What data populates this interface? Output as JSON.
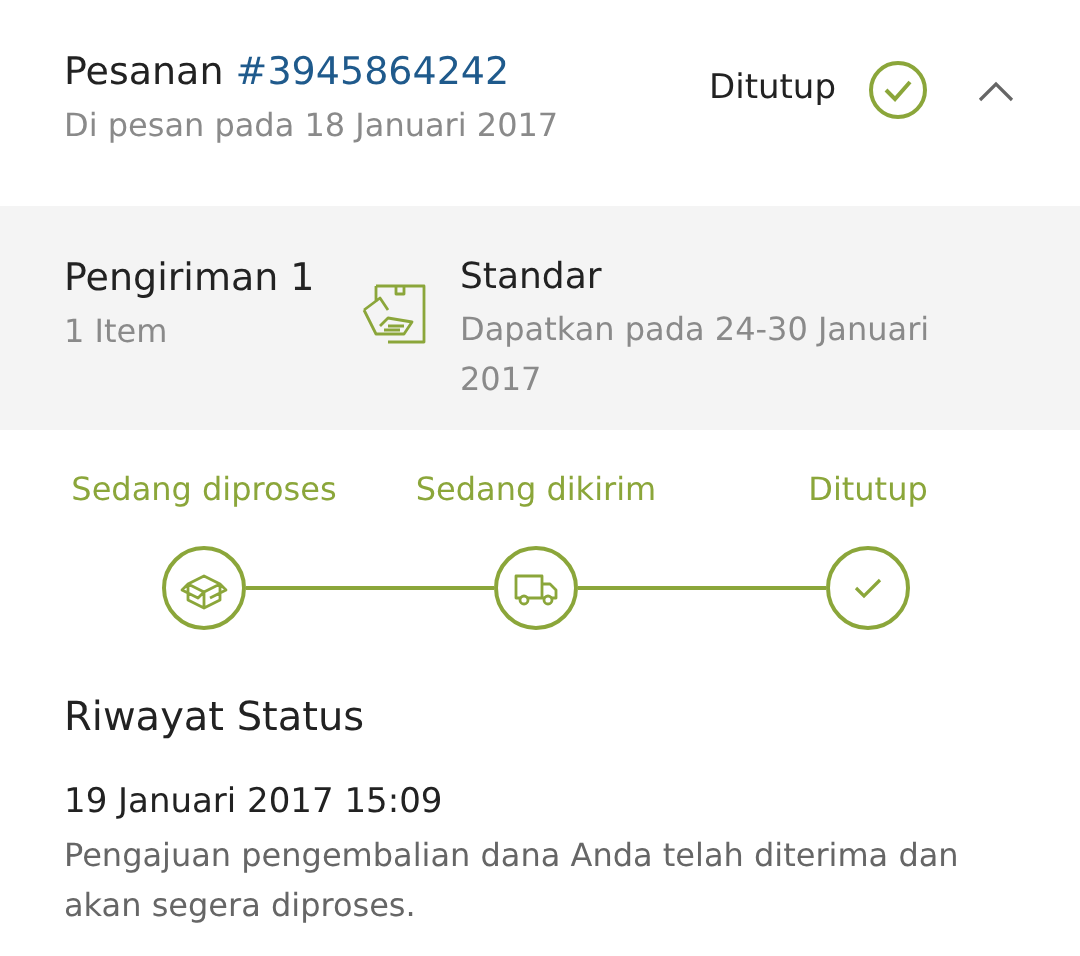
{
  "order": {
    "label": "Pesanan",
    "number": "#3945864242",
    "date": "Di pesan pada 18 Januari 2017",
    "status": "Ditutup",
    "status_done": true,
    "expanded": true
  },
  "shipment": {
    "title": "Pengiriman 1",
    "items": "1 Item",
    "method": "Standar",
    "estimate": "Dapatkan pada 24-30 Januari 2017"
  },
  "steps": [
    {
      "label": "Sedang diproses",
      "kind": "box",
      "done": true
    },
    {
      "label": "Sedang dikirim",
      "kind": "truck",
      "done": true
    },
    {
      "label": "Ditutup",
      "kind": "check",
      "done": true
    }
  ],
  "history": {
    "title": "Riwayat Status",
    "entries": [
      {
        "time": "19 Januari 2017 15:09",
        "text": "Pengajuan pengembalian dana Anda telah diterima dan akan segera diproses."
      }
    ]
  }
}
